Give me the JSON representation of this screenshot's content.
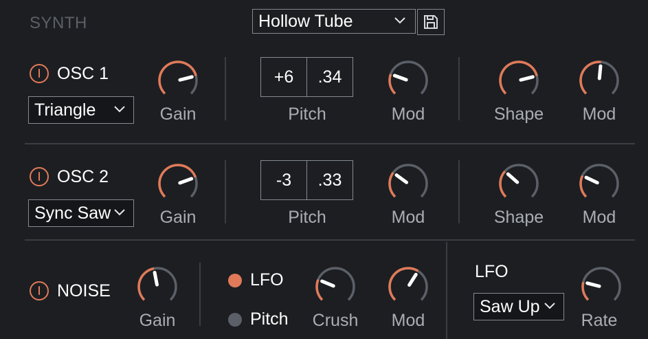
{
  "section": {
    "title": "SYNTH"
  },
  "preset": {
    "name": "Hollow Tube"
  },
  "colors": {
    "accent": "#e07a58",
    "track": "#5b6068",
    "pointer": "#ffffff",
    "background": "#1d1e22"
  },
  "osc1": {
    "label": "OSC 1",
    "waveform": "Triangle",
    "gain": {
      "label": "Gain",
      "value": 0.78
    },
    "pitch": {
      "label": "Pitch",
      "semitones": "+6",
      "fine": ".34"
    },
    "pitch_mod": {
      "label": "Mod",
      "value": 0.24
    },
    "shape": {
      "label": "Shape",
      "value": 0.78
    },
    "shape_mod": {
      "label": "Mod",
      "value": 0.52
    }
  },
  "osc2": {
    "label": "OSC 2",
    "waveform": "Sync Saw",
    "gain": {
      "label": "Gain",
      "value": 0.76
    },
    "pitch": {
      "label": "Pitch",
      "semitones": "-3",
      "fine": ".33"
    },
    "pitch_mod": {
      "label": "Mod",
      "value": 0.3
    },
    "shape": {
      "label": "Shape",
      "value": 0.32
    },
    "shape_mod": {
      "label": "Mod",
      "value": 0.26
    }
  },
  "noise": {
    "label": "NOISE",
    "gain": {
      "label": "Gain",
      "value": 0.46
    },
    "routing": [
      {
        "label": "LFO",
        "selected": true,
        "color": "#e07a58"
      },
      {
        "label": "Pitch",
        "selected": false,
        "color": "#5b6068"
      }
    ],
    "crush": {
      "label": "Crush",
      "value": 0.25
    },
    "mod": {
      "label": "Mod",
      "value": 0.62
    }
  },
  "lfo": {
    "title": "LFO",
    "waveform": "Saw Up",
    "rate": {
      "label": "Rate",
      "value": 0.22
    }
  }
}
